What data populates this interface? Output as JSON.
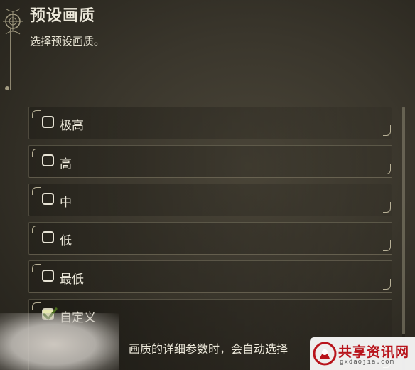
{
  "header": {
    "title": "预设画质",
    "subtitle": "选择预设画质。"
  },
  "options": [
    {
      "label": "极高",
      "checked": false
    },
    {
      "label": "高",
      "checked": false
    },
    {
      "label": "中",
      "checked": false
    },
    {
      "label": "低",
      "checked": false
    },
    {
      "label": "最低",
      "checked": false
    },
    {
      "label": "自定义",
      "checked": true,
      "description": "画质的详细参数时，会自动选择"
    }
  ],
  "watermark": {
    "text": "共享资讯网",
    "url": "gxdaojia.com"
  },
  "colors": {
    "checkbox_fill": "#e6e8b0",
    "check_mark": "#4a6e1c",
    "watermark_red": "#b8141b"
  },
  "icons": {
    "corner": "ornate-corner-icon",
    "checkbox_empty": "checkbox-empty-icon",
    "checkbox_checked": "checkmark-icon",
    "watermark": "watermark-logo-icon"
  }
}
